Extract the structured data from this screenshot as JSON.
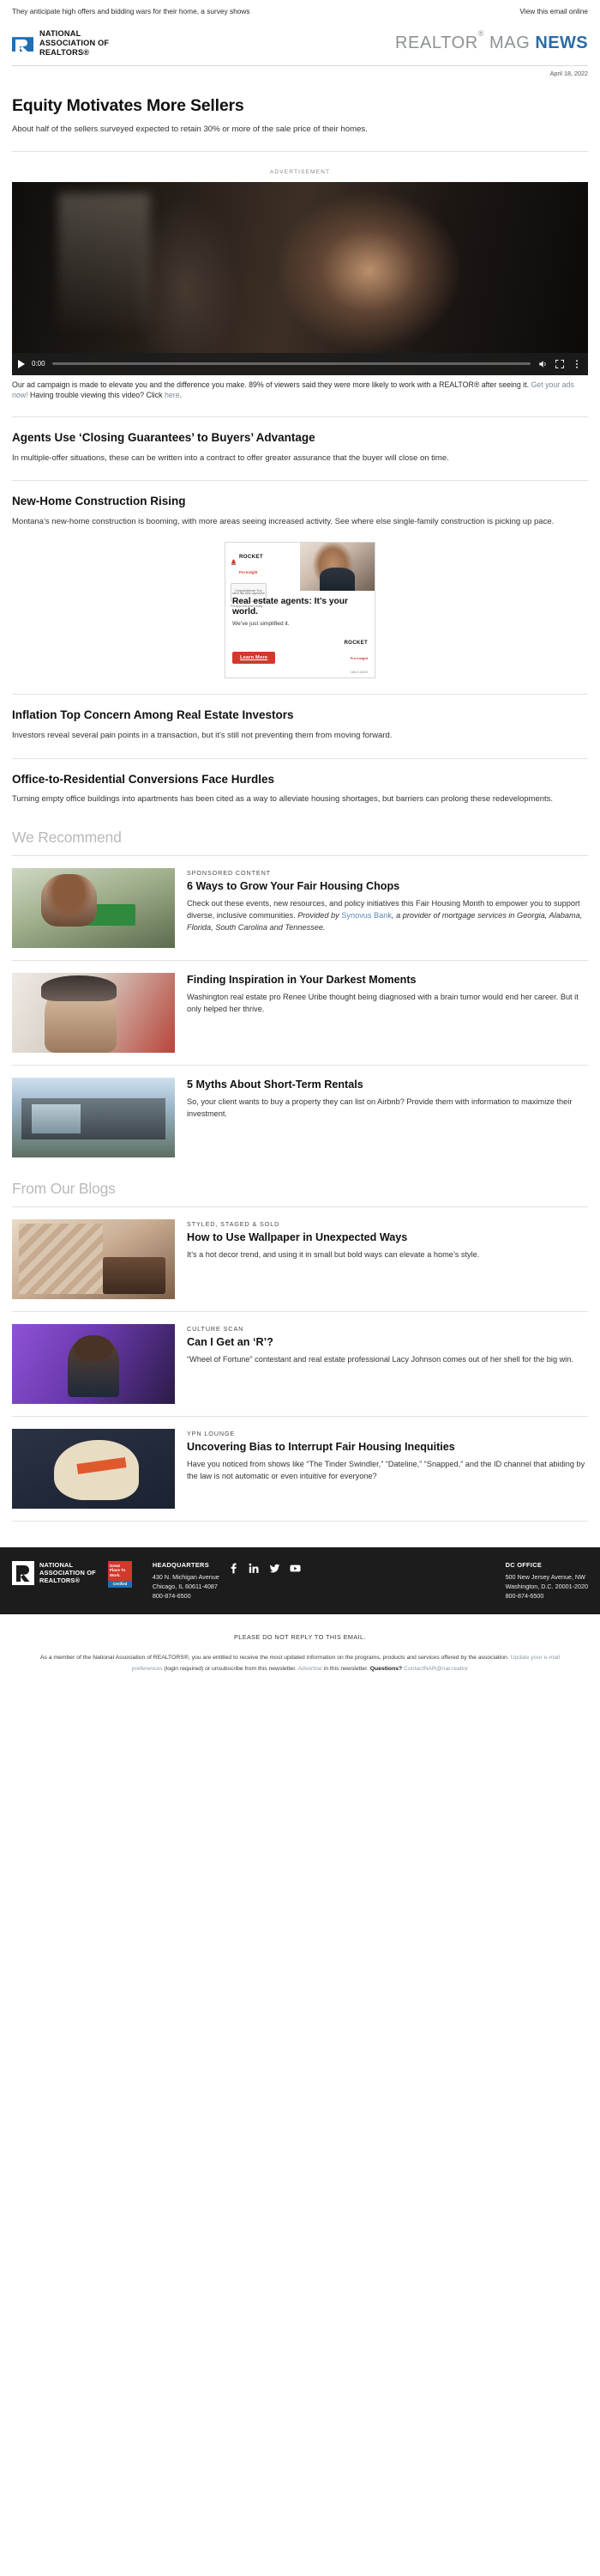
{
  "preheader": {
    "text": "They anticipate high offers and bidding wars for their home, a survey shows",
    "view_online": "View this email online"
  },
  "masthead": {
    "logo_line1": "NATIONAL",
    "logo_line2": "ASSOCIATION OF",
    "logo_line3": "REALTORS®",
    "brand_gray": "REALTOR",
    "brand_sup": "®",
    "brand_gray2": "MAG",
    "brand_blue": "NEWS",
    "date": "April 18, 2022"
  },
  "lead": {
    "headline": "Equity Motivates More Sellers",
    "deck": "About half of the sellers surveyed expected to retain 30% or more of the sale price of their homes."
  },
  "ad_label": "ADVERTISEMENT",
  "video": {
    "time": "0:00",
    "play_icon": "play-icon",
    "volume_icon": "volume-icon",
    "fullscreen_icon": "fullscreen-icon",
    "more_icon": "kebab-menu-icon",
    "caption_part1": "Our ad campaign is made to elevate you and the difference you make. 89% of viewers said they were more likely to work with a REALTOR® after seeing it. ",
    "caption_link1": "Get your ads now!",
    "caption_part2": " Having trouble viewing this video? Click ",
    "caption_link2": "here",
    "caption_end": "."
  },
  "stories": [
    {
      "title": "Agents Use ‘Closing Guarantees’ to Buyers’ Advantage",
      "body": "In multiple-offer situations, these can be written into a contract to offer greater assurance that the buyer will close on time."
    },
    {
      "title": "New-Home Construction Rising",
      "body": "Montana’s new-home construction is booming, with more areas seeing increased activity. See where else single-family construction is picking up pace."
    }
  ],
  "promo": {
    "logo_name": "ROCKET",
    "logo_sub": "Pro Insight",
    "badge_text": "Congratulations! Your client has been approved!",
    "badge_sub": "Pre-approval letter ready",
    "headline": "Real estate agents: It’s your world.",
    "subtext": "We’ve just simplified it.",
    "cta": "Learn More",
    "brand_name": "ROCKET",
    "brand_sub": "Pro Insight",
    "nmls": "NMLS #3030"
  },
  "stories2": [
    {
      "title": "Inflation Top Concern Among Real Estate Investors",
      "body": "Investors reveal several pain points in a transaction, but it’s still not preventing them from moving forward."
    },
    {
      "title": "Office-to-Residential Conversions Face Hurdles",
      "body": "Turning empty office buildings into apartments has been cited as a way to alleviate housing shortages, but barriers can prolong these redevelopments."
    }
  ],
  "recommend": {
    "heading": "We Recommend",
    "cards": [
      {
        "thumb": "equal-housing-sign-image",
        "kicker": "SPONSORED CONTENT",
        "title": "6 Ways to Grow Your Fair Housing Chops",
        "body_part1": "Check out these events, new resources, and policy initiatives this Fair Housing Month to empower you to support diverse, inclusive communities. ",
        "body_italic_pre": "Provided by ",
        "body_link": "Synovus Bank",
        "body_italic_post": ", a provider of mortgage services in Georgia, Alabama, Florida, South Carolina and Tennessee."
      },
      {
        "thumb": "woman-portrait-image",
        "kicker": "",
        "title": "Finding Inspiration in Your Darkest Moments",
        "body_part1": "Washington real estate pro Renee Uribe thought being diagnosed with a brain tumor would end her career. But it only helped her thrive.",
        "body_italic_pre": "",
        "body_link": "",
        "body_italic_post": ""
      },
      {
        "thumb": "modern-house-image",
        "kicker": "",
        "title": "5 Myths About Short-Term Rentals",
        "body_part1": "So, your client wants to buy a property they can list on Airbnb? Provide them with information to maximize their investment.",
        "body_italic_pre": "",
        "body_link": "",
        "body_italic_post": ""
      }
    ]
  },
  "blogs": {
    "heading": "From Our Blogs",
    "cards": [
      {
        "thumb": "wallpaper-room-image",
        "kicker": "STYLED, STAGED & SOLD",
        "title": "How to Use Wallpaper in Unexpected Ways",
        "body": "It’s a hot decor trend, and using it in small but bold ways can elevate a home’s style."
      },
      {
        "thumb": "wheel-of-fortune-contestant-image",
        "kicker": "CULTURE SCAN",
        "title": "Can I Get an ‘R’?",
        "body": "“Wheel of Fortune” contestant and real estate professional Lacy Johnson comes out of her shell for the big win."
      },
      {
        "thumb": "bias-head-illustration-image",
        "kicker": "YPN LOUNGE",
        "title": "Uncovering Bias to Interrupt Fair Housing Inequities",
        "body": "Have you noticed from shows like “The Tinder Swindler,” “Dateline,” “Snapped,” and the ID channel that abiding by the law is not automatic or even intuitive for everyone?"
      }
    ]
  },
  "footer": {
    "logo_line1": "NATIONAL",
    "logo_line2": "ASSOCIATION OF",
    "logo_line3": "REALTORS®",
    "gptw_line1": "Great Place To Work.",
    "gptw_line2": "Certified",
    "hq_title": "HEADQUARTERS",
    "hq_line1": "430 N. Michigan Avenue",
    "hq_line2": "Chicago, IL 60611-4087",
    "hq_line3": "800-874-6500",
    "dc_title": "DC OFFICE",
    "dc_line1": "500 New Jersey Avenue, NW",
    "dc_line2": "Washington, D.C. 20001-2020",
    "dc_line3": "800-874-6500",
    "social": [
      "facebook-icon",
      "linkedin-icon",
      "twitter-icon",
      "youtube-icon"
    ]
  },
  "bottom": {
    "noreply": "PLEASE DO NOT REPLY TO THIS EMAIL.",
    "legal_part1": "As a member of the National Association of REALTORS®, you are entitled to receive the most updated information on the programs, products and services offered by the association. ",
    "legal_link1": "Update your e-mail preferences",
    "legal_part2": " (login required) or unsubscribe from this newsletter. ",
    "legal_link2": "Advertise",
    "legal_part3": " in this newsletter. ",
    "legal_bold": "Questions?",
    "legal_part4": " ",
    "legal_link3": "ContactNAR@nar.realtor"
  },
  "colors": {
    "brand_blue": "#2c6ca8",
    "logo_blue": "#1f6fb2",
    "accent_red": "#d1392b",
    "link_gray_blue": "#7a8a99",
    "footer_bg": "#1c1c1c"
  }
}
